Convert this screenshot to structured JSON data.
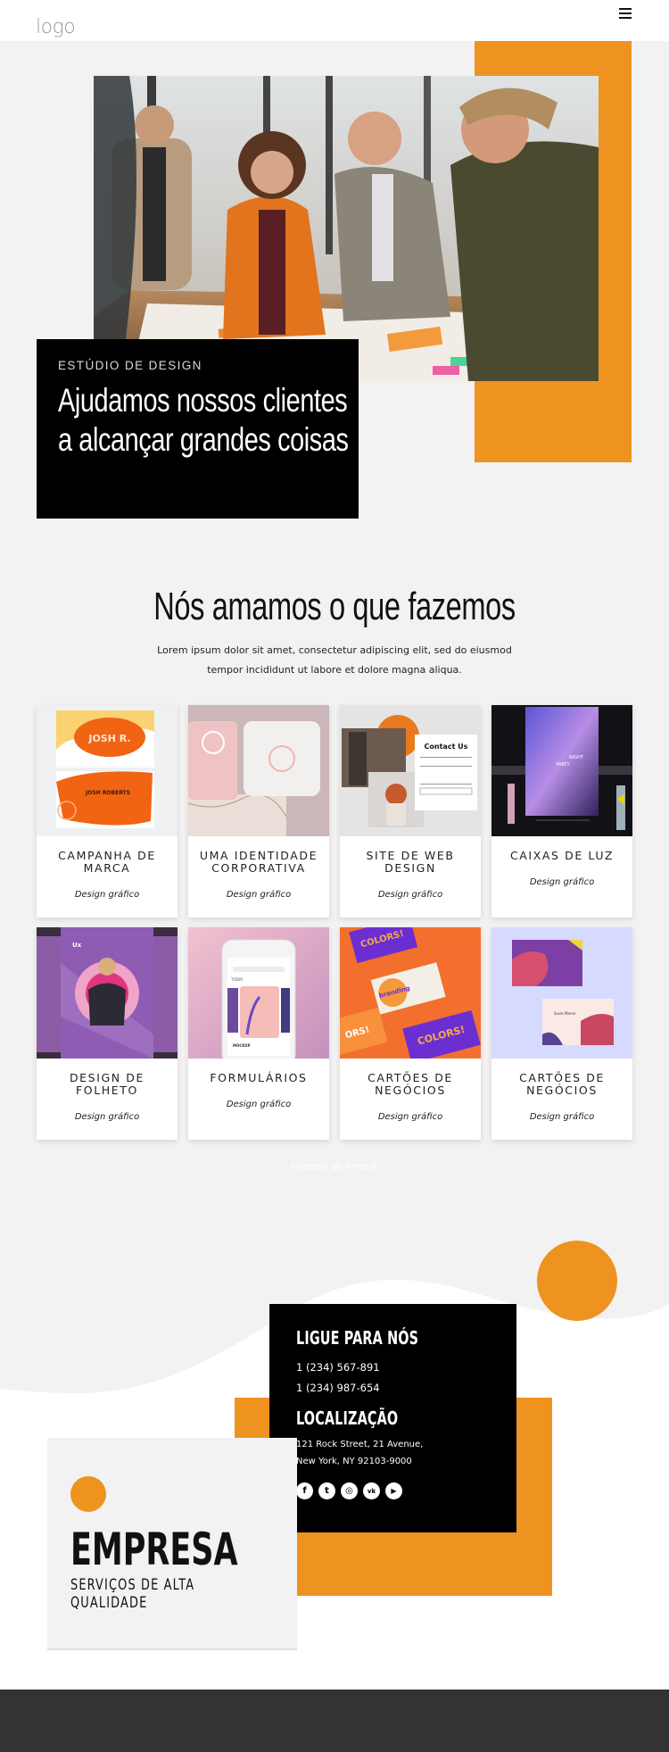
{
  "header": {
    "logo": "logo",
    "menu_icon": "hamburger-menu-icon"
  },
  "hero": {
    "kicker": "ESTÚDIO DE DESIGN",
    "title": "Ajudamos nossos clientes a alcançar grandes coisas",
    "image_alt": "team-meeting-photo"
  },
  "services": {
    "title": "Nós amamos o que fazemos",
    "text": "Lorem ipsum dolor sit amet, consectetur adipiscing elit, sed do eiusmod tempor incididunt ut labore et dolore magna aliqua.",
    "cards": [
      {
        "title": "CAMPANHA DE MARCA",
        "subtitle": "Design gráfico",
        "image": "business-card-mockup-orange"
      },
      {
        "title": "UMA IDENTIDADE CORPORATIVA",
        "subtitle": "Design gráfico",
        "image": "corporate-identity-pink"
      },
      {
        "title": "SITE DE WEB DESIGN",
        "subtitle": "Design gráfico",
        "image": "contact-form-mockup"
      },
      {
        "title": "CAIXAS DE LUZ",
        "subtitle": "Design gráfico",
        "image": "night-party-lightbox"
      },
      {
        "title": "DESIGN DE FOLHETO",
        "subtitle": "Design gráfico",
        "image": "purple-flyer"
      },
      {
        "title": "FORMULÁRIOS",
        "subtitle": "Design gráfico",
        "image": "phone-mockup"
      },
      {
        "title": "CARTÕES DE NEGÓCIOS",
        "subtitle": "Design gráfico",
        "image": "colors-branding-cards"
      },
      {
        "title": "CARTÕES DE NEGÓCIOS",
        "subtitle": "Design gráfico",
        "image": "susie-marse-cards"
      }
    ],
    "credit": "Imagens de Freepik"
  },
  "contact": {
    "call_heading": "LIGUE PARA NÓS",
    "phones": [
      "1 (234) 567-891",
      "1 (234) 987-654"
    ],
    "location_heading": "LOCALIZAÇÃO",
    "address": [
      "121 Rock Street, 21 Avenue,",
      "New York, NY 92103-9000"
    ],
    "socials": [
      {
        "name": "facebook",
        "glyph": "f"
      },
      {
        "name": "twitter",
        "glyph": "t"
      },
      {
        "name": "instagram",
        "glyph": "◎"
      },
      {
        "name": "vk",
        "glyph": "vk"
      },
      {
        "name": "youtube",
        "glyph": "▶"
      }
    ]
  },
  "company": {
    "name": "EMPRESA",
    "tagline": "SERVIÇOS DE ALTA QUALIDADE"
  },
  "colors": {
    "accent": "#ee931f",
    "background_gray": "#f2f2f2",
    "dark": "#000000",
    "footer": "#333333"
  }
}
